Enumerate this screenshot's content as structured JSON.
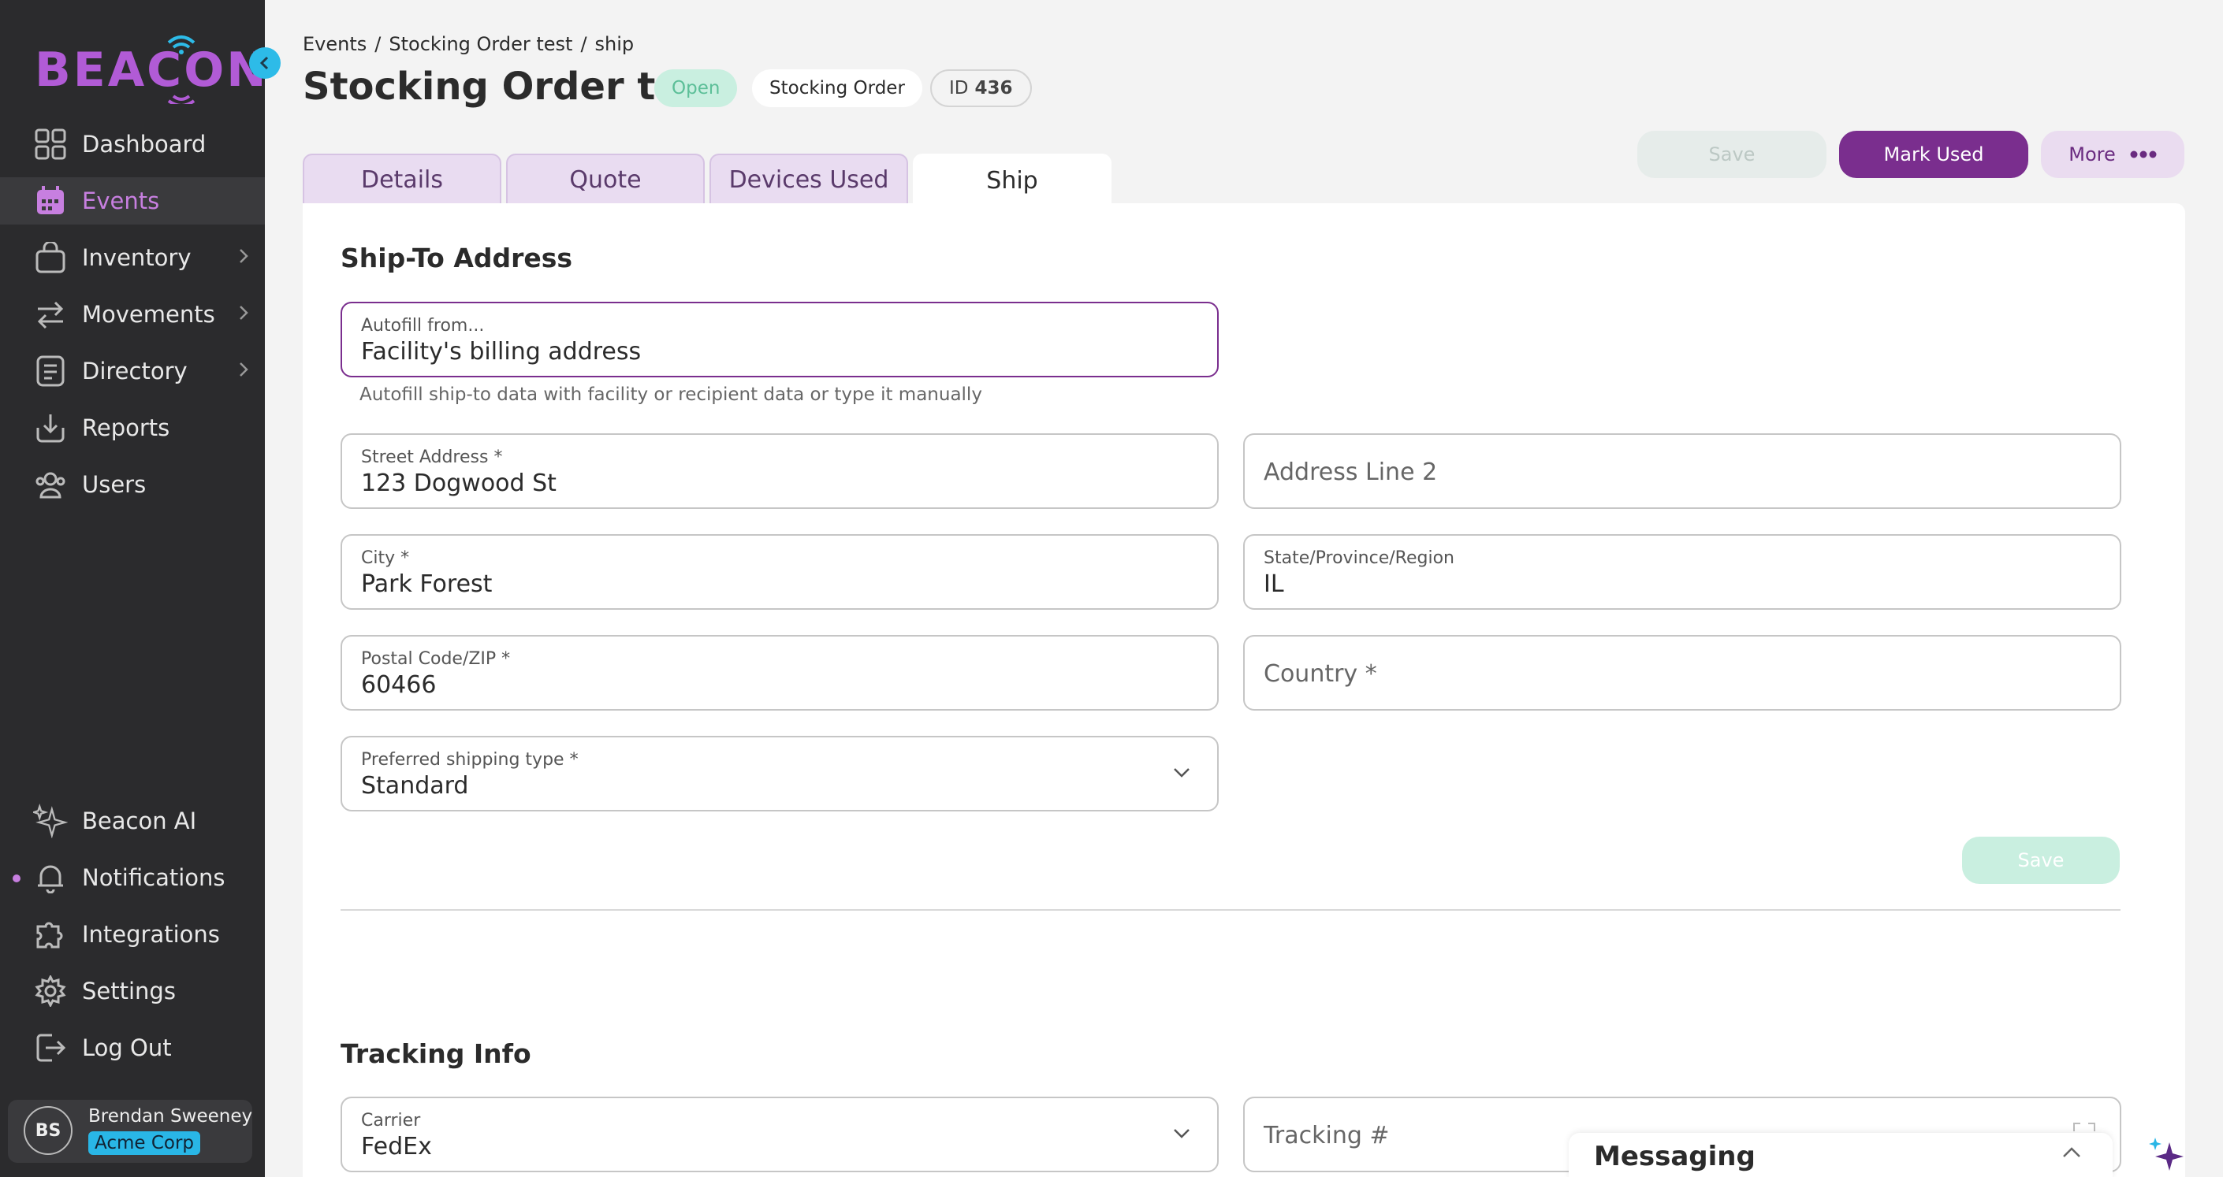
{
  "app": {
    "logo_text": "BEACON"
  },
  "sidebar": {
    "items": [
      {
        "label": "Dashboard",
        "icon": "dashboard-grid-icon"
      },
      {
        "label": "Events",
        "icon": "calendar-icon"
      },
      {
        "label": "Inventory",
        "icon": "bag-icon"
      },
      {
        "label": "Movements",
        "icon": "arrows-swap-icon"
      },
      {
        "label": "Directory",
        "icon": "document-list-icon"
      },
      {
        "label": "Reports",
        "icon": "download-tray-icon"
      },
      {
        "label": "Users",
        "icon": "users-group-icon"
      }
    ],
    "bottom_items": [
      {
        "label": "Beacon AI",
        "icon": "sparkle-icon"
      },
      {
        "label": "Notifications",
        "icon": "bell-icon"
      },
      {
        "label": "Integrations",
        "icon": "puzzle-icon"
      },
      {
        "label": "Settings",
        "icon": "gear-icon"
      },
      {
        "label": "Log Out",
        "icon": "logout-icon"
      }
    ],
    "user": {
      "initials": "BS",
      "name": "Brendan Sweeney",
      "org": "Acme Corp"
    }
  },
  "breadcrumb": [
    "Events",
    "/",
    "Stocking Order test",
    "/",
    "ship"
  ],
  "header": {
    "title": "Stocking Order test",
    "status": "Open",
    "type": "Stocking Order",
    "id_label": "ID",
    "id_value": "436"
  },
  "actions": {
    "save": "Save",
    "mark_used": "Mark Used",
    "more": "More"
  },
  "tabs": [
    {
      "label": "Details"
    },
    {
      "label": "Quote"
    },
    {
      "label": "Devices Used"
    },
    {
      "label": "Ship"
    }
  ],
  "ship_to": {
    "title": "Ship-To Address",
    "autofill": {
      "label": "Autofill from...",
      "value": "Facility's billing address"
    },
    "helper": "Autofill ship-to data with facility or recipient data or type it manually",
    "street": {
      "label": "Street Address *",
      "value": "123 Dogwood St"
    },
    "line2": {
      "placeholder": "Address Line 2"
    },
    "city": {
      "label": "City *",
      "value": "Park Forest"
    },
    "state": {
      "label": "State/Province/Region",
      "value": "IL"
    },
    "postal": {
      "label": "Postal Code/ZIP *",
      "value": "60466"
    },
    "country": {
      "placeholder": "Country *"
    },
    "shipping_type": {
      "label": "Preferred shipping type *",
      "value": "Standard"
    },
    "save": "Save"
  },
  "tracking": {
    "title": "Tracking Info",
    "carrier": {
      "label": "Carrier",
      "value": "FedEx"
    },
    "tracking_number": {
      "placeholder": "Tracking #"
    }
  },
  "messaging": {
    "title": "Messaging"
  },
  "colors": {
    "brand_purple": "#7a2e8e",
    "sidebar_bg": "#2b2b2d",
    "accent_cyan": "#29b6e6",
    "status_open": "#5cbf98"
  }
}
